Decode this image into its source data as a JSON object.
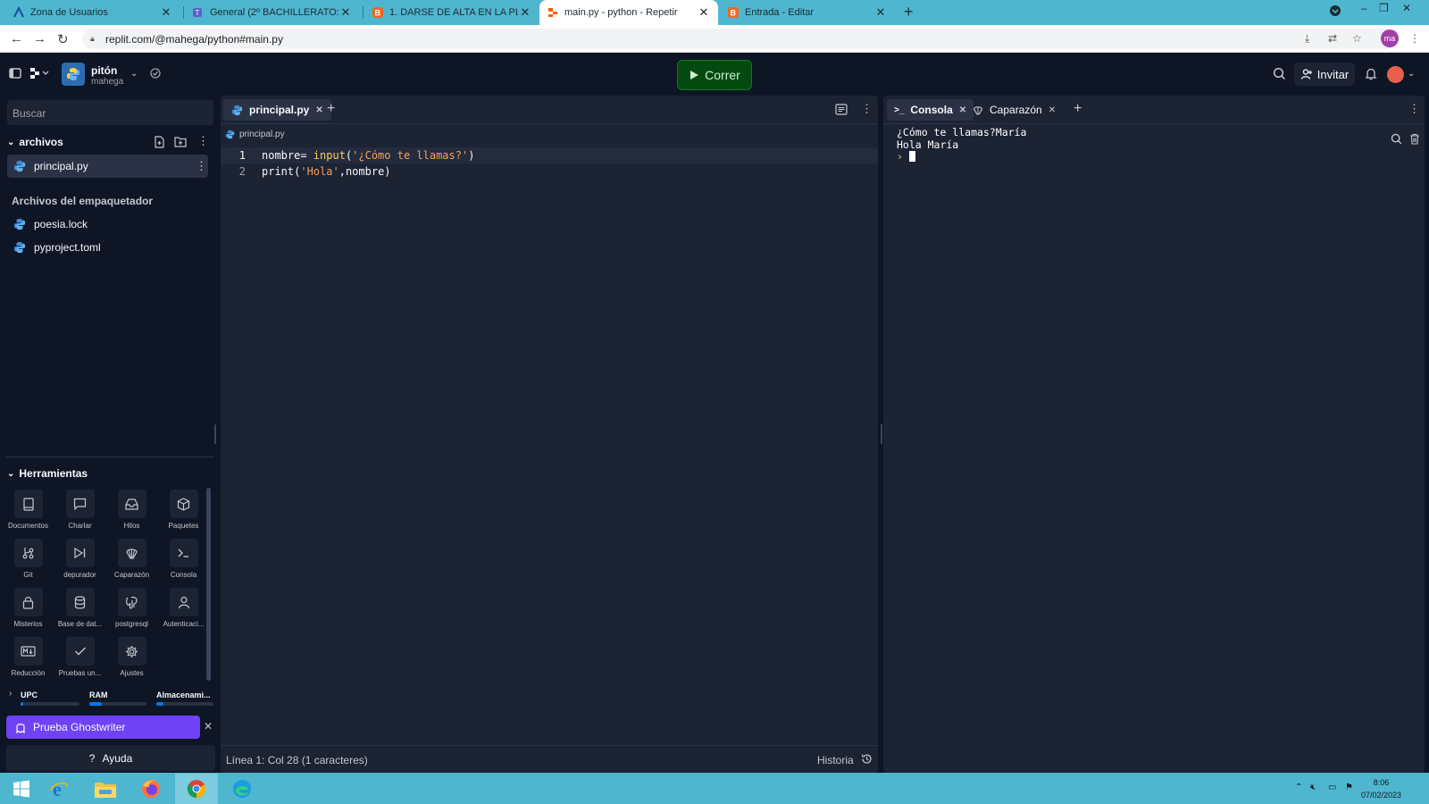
{
  "browser": {
    "tabs": [
      {
        "title": "Zona de Usuarios",
        "icon": "aula-icon"
      },
      {
        "title": "General (2º BACHILLERATO: TIC (",
        "icon": "teams-icon"
      },
      {
        "title": "1. DARSE DE ALTA EN LA PLATAF",
        "icon": "blogger-icon"
      },
      {
        "title": "main.py - python - Repetir",
        "icon": "replit-icon"
      },
      {
        "title": "Entrada - Editar",
        "icon": "blogger-icon"
      }
    ],
    "url": "replit.com/@mahega/python#main.py",
    "profile": "ma"
  },
  "header": {
    "repl_name": "pitón",
    "owner": "mahega",
    "run_label": "Correr",
    "invite_label": "Invitar"
  },
  "sidebar": {
    "search_placeholder": "Buscar",
    "files_title": "archivos",
    "files": [
      {
        "name": "principal.py"
      }
    ],
    "packager_title": "Archivos del empaquetador",
    "packager_files": [
      {
        "name": "poesia.lock"
      },
      {
        "name": "pyproject.toml"
      }
    ],
    "tools_title": "Herramientas",
    "tools": [
      {
        "label": "Documentos",
        "icon": "book-icon"
      },
      {
        "label": "Charlar",
        "icon": "chat-icon"
      },
      {
        "label": "Hilos",
        "icon": "inbox-icon"
      },
      {
        "label": "Paquetes",
        "icon": "package-icon"
      },
      {
        "label": "Git",
        "icon": "git-icon"
      },
      {
        "label": "depurador",
        "icon": "debugger-icon"
      },
      {
        "label": "Caparazón",
        "icon": "shell-icon"
      },
      {
        "label": "Consola",
        "icon": "console-icon"
      },
      {
        "label": "Misterios",
        "icon": "lock-icon"
      },
      {
        "label": "Base de dat...",
        "icon": "database-icon"
      },
      {
        "label": "postgresql",
        "icon": "postgresql-icon"
      },
      {
        "label": "Autenticaci...",
        "icon": "user-icon"
      },
      {
        "label": "Reducción",
        "icon": "markdown-icon"
      },
      {
        "label": "Pruebas un...",
        "icon": "check-icon"
      },
      {
        "label": "Ajustes",
        "icon": "gear-icon"
      }
    ],
    "resources": [
      {
        "label": "UPC",
        "fill": 0.05
      },
      {
        "label": "RAM",
        "fill": 0.22
      },
      {
        "label": "Almacenami...",
        "fill": 0.12
      }
    ],
    "ghostwriter_label": "Prueba Ghostwriter",
    "help_label": "Ayuda"
  },
  "editor": {
    "tab_label": "principal.py",
    "breadcrumb": "principal.py",
    "lines": [
      {
        "num": "1",
        "parts": [
          {
            "t": "nombre= ",
            "c": ""
          },
          {
            "t": "input",
            "c": "kw"
          },
          {
            "t": "(",
            "c": ""
          },
          {
            "t": "'¿Cómo te llamas?'",
            "c": "str"
          },
          {
            "t": ")",
            "c": ""
          }
        ]
      },
      {
        "num": "2",
        "parts": [
          {
            "t": "print(",
            "c": ""
          },
          {
            "t": "'Hola'",
            "c": "str"
          },
          {
            "t": ",nombre)",
            "c": ""
          }
        ]
      }
    ],
    "status": "Línea 1: Col 28 (1 caracteres)",
    "history_label": "Historia"
  },
  "console": {
    "tabs": [
      {
        "label": "Consola"
      },
      {
        "label": "Caparazón"
      }
    ],
    "output_lines": [
      "¿Cómo te llamas?María",
      "Hola María"
    ],
    "prompt": "›"
  },
  "taskbar": {
    "time": "8:06",
    "date": "07/02/2023"
  },
  "colors": {
    "accent_run": "#044a10",
    "ghostwriter": "#6f42f5",
    "panel": "#1c2333",
    "background": "#0e1525",
    "browser_chrome": "#4fb6cf"
  }
}
